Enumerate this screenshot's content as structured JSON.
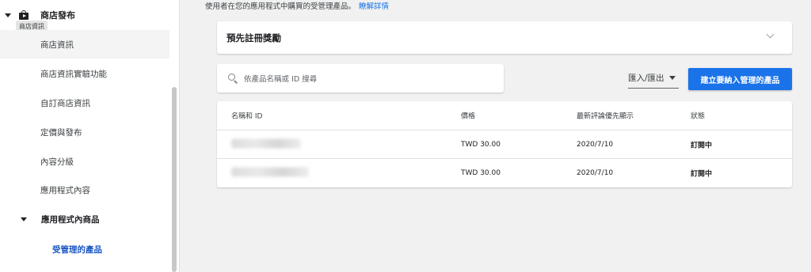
{
  "sidebar": {
    "header": "商店發布",
    "tooltip": "商店資訊",
    "items": [
      {
        "label": "商店資訊"
      },
      {
        "label": "商店資訊實驗功能"
      },
      {
        "label": "自訂商店資訊"
      },
      {
        "label": "定價與發布"
      },
      {
        "label": "內容分級"
      },
      {
        "label": "應用程式內容"
      }
    ],
    "section": "應用程式內商品",
    "subitem": "受管理的產品"
  },
  "description": {
    "text": "使用者在您的應用程式中購買的受管理產品。",
    "link": "瞭解詳情"
  },
  "prereg": {
    "title": "預先註冊獎勵"
  },
  "search": {
    "placeholder": "依產品名稱或 ID 搜尋"
  },
  "toolbar": {
    "import_export": "匯入/匯出",
    "create_label": "建立要納入管理的產品"
  },
  "table": {
    "headers": [
      "名稱和 ID",
      "價格",
      "最新評論優先顯示",
      "狀態"
    ],
    "rows": [
      {
        "price": "TWD 30.00",
        "date": "2020/7/10",
        "status": "訂閱中"
      },
      {
        "price": "TWD 30.00",
        "date": "2020/7/10",
        "status": "訂閱中"
      }
    ]
  },
  "colors": {
    "accent": "#1a73e8",
    "active_nav": "#1a56c2"
  }
}
